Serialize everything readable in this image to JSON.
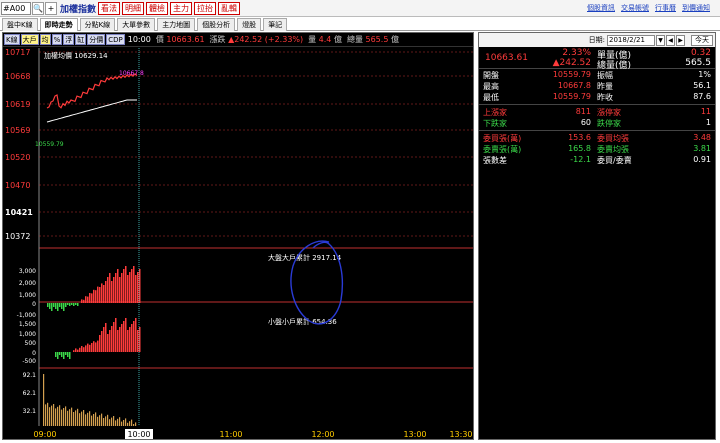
{
  "toolbar": {
    "code_value": "#A00",
    "index_name": "加權指數",
    "buttons": [
      "看法",
      "明細",
      "體檢",
      "主力",
      "拉抬",
      "亂輯"
    ],
    "links": [
      "個股資訊",
      "交易帳號",
      "行事曆",
      "到價通知"
    ]
  },
  "tabs": [
    "盤中K線",
    "即時走勢",
    "分點K線",
    "大單參數",
    "主力地圖",
    "個股分析",
    "燈股",
    "筆記"
  ],
  "active_tab": 1,
  "chart_toolbar": {
    "buttons": [
      "K線",
      "大戶",
      "均",
      "%",
      "浮",
      "缸",
      "分價",
      "CDP"
    ],
    "time": "10:00",
    "price_label": "價",
    "price": "10663.61",
    "change_label": "漲跌",
    "change": "▲242.52 (+2.33%)",
    "volume_label": "量",
    "volume": "4.4",
    "volume_unit": "億",
    "total_label": "總量",
    "total": "565.5",
    "total_unit": "億"
  },
  "chart": {
    "axis_labels": [
      "10717",
      "10668",
      "10619",
      "10569",
      "10520",
      "10470",
      "10421",
      "10372"
    ],
    "ma_label": "加權均價 10629.14",
    "high_mark": "10667.8",
    "low_mark": "10559.79",
    "panel2_label": "大盤大戶累計 2917.14",
    "panel2_ticks": [
      "3,000",
      "2,000",
      "1,000",
      "0",
      "-1,000"
    ],
    "panel3_label": "小盤小戶累計 654.36",
    "panel3_ticks": [
      "1,500",
      "1,000",
      "500",
      "0",
      "-500"
    ],
    "panel4_ticks": [
      "92.1",
      "62.1",
      "32.1"
    ],
    "time_labels": [
      "09:00",
      "10:00",
      "11:00",
      "12:00",
      "13:00",
      "13:30"
    ],
    "colors": {
      "up": "#ff3b3b",
      "down": "#3bd94a",
      "ma": "#ffffff",
      "grid": "#c03030",
      "cursor": "#4ad0d0",
      "annotation": "#2a3bd6"
    }
  },
  "quote": {
    "date_label": "日期:",
    "date": "2018/2/21",
    "today_button": "今天",
    "price": "10663.61",
    "pct": "2.33%",
    "chg": "▲242.52",
    "unit_vol_label": "單量(億)",
    "unit_vol": "0.32",
    "total_vol_label": "總量(億)",
    "total_vol": "565.5",
    "rows": [
      {
        "l": "開盤",
        "v": "10559.79",
        "l2": "振幅",
        "v2": "1%"
      },
      {
        "l": "最高",
        "v": "10667.8",
        "l2": "昨量",
        "v2": "56.1"
      },
      {
        "l": "最低",
        "v": "10559.79",
        "l2": "昨收",
        "v2": "87.6"
      }
    ],
    "rows2": [
      {
        "l": "上漲家",
        "v": "811",
        "l2": "漲停家",
        "v2": "11"
      },
      {
        "l": "下跌家",
        "v": "60",
        "l2": "跌停家",
        "v2": "1"
      }
    ],
    "rows3": [
      {
        "l": "委買張(萬)",
        "v": "153.6",
        "l2": "委買均張",
        "v2": "3.48"
      },
      {
        "l": "委賣張(萬)",
        "v": "165.8",
        "l2": "委賣均張",
        "v2": "3.81"
      },
      {
        "l": "張數差",
        "v": "-12.1",
        "l2": "委買/委賣",
        "v2": "0.91"
      }
    ]
  }
}
